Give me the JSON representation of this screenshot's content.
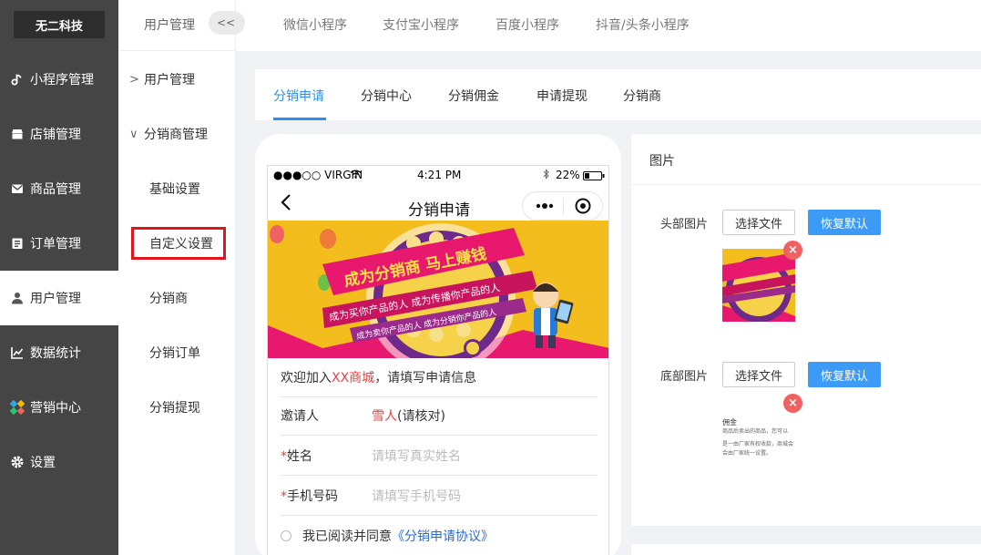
{
  "app": {
    "logo": "无二科技"
  },
  "left_nav": [
    {
      "label": "小程序管理",
      "icon": "link-icon"
    },
    {
      "label": "店铺管理",
      "icon": "store-icon"
    },
    {
      "label": "商品管理",
      "icon": "mail-icon"
    },
    {
      "label": "订单管理",
      "icon": "clipboard-icon"
    },
    {
      "label": "用户管理",
      "icon": "user-icon",
      "active": true
    },
    {
      "label": "数据统计",
      "icon": "chart-icon"
    },
    {
      "label": "营销中心",
      "icon": "marketing-icon"
    },
    {
      "label": "设置",
      "icon": "gear-icon"
    }
  ],
  "sub_nav": {
    "title": "用户管理",
    "collapse_label": "<<",
    "groups": [
      {
        "label": "用户管理",
        "arrow": ">"
      },
      {
        "label": "分销商管理",
        "arrow": "∨"
      }
    ],
    "children": [
      "基础设置",
      "自定义设置",
      "分销商",
      "分销订单",
      "分销提现"
    ]
  },
  "top_tabs": [
    "微信小程序",
    "支付宝小程序",
    "百度小程序",
    "抖音/头条小程序"
  ],
  "content_tabs": [
    "分销申请",
    "分销中心",
    "分销佣金",
    "申请提现",
    "分销商"
  ],
  "phone": {
    "carrier": "●●●○○ VIRGIN",
    "time": "4:21 PM",
    "battery": "22%",
    "title": "分销申请",
    "banner": {
      "headline": "成为分销商 马上赚钱",
      "line1": "成为买你产品的人 成为传播你产品的人",
      "line2": "成为卖你产品的人 成为分销你产品的人"
    },
    "welcome_prefix": "欢迎加入",
    "welcome_shop": "XX商城",
    "welcome_suffix": "，请填写申请信息",
    "inviter_label": "邀请人",
    "inviter_name": "雪人",
    "inviter_note": "(请核对)",
    "name_label": "姓名",
    "name_placeholder": "请填写真实姓名",
    "phone_label": "手机号码",
    "phone_placeholder": "请填写手机号码",
    "agree_text": "我已阅读并同意",
    "agree_link": "《分销申请协议》",
    "required_mark": "*"
  },
  "image_panel": {
    "title": "图片",
    "header_label": "头部图片",
    "footer_label": "底部图片",
    "choose_file": "选择文件",
    "restore_default": "恢复默认",
    "delete_mark": "×",
    "footer_thumb_text": {
      "t1": "佣金",
      "t2": "商品后卖出的商品，您可以",
      "t3": "是一由厂家有权收款，商城会",
      "t4": "会由厂家统一设置。"
    }
  },
  "colors": {
    "accent": "#2a8ff0",
    "highlight": "#e0161f",
    "sidebar": "#454545",
    "danger": "#f06262"
  }
}
